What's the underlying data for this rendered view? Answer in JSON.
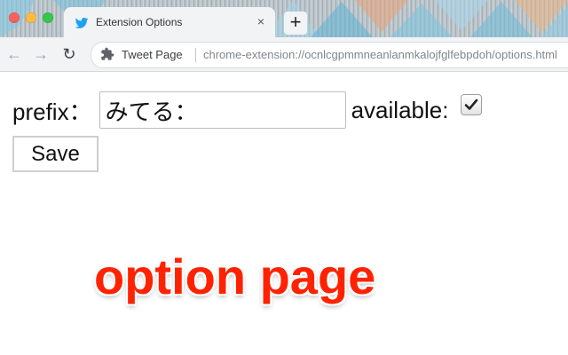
{
  "browser": {
    "tab": {
      "title": "Extension Options",
      "close_glyph": "×"
    },
    "new_tab_glyph": "+",
    "nav": {
      "back_glyph": "←",
      "forward_glyph": "→",
      "reload_glyph": "↻"
    },
    "omnibox": {
      "extension_name": "Tweet Page",
      "url": "chrome-extension://ocnlcgpmmneanlanmkalojfglfebpdoh/options.html"
    },
    "colors": {
      "close": "#fc605b",
      "minimize": "#fdbc40",
      "maximize": "#34c749",
      "tab_bg": "#f1f3f4",
      "twitter_blue": "#1da1f2"
    }
  },
  "options_form": {
    "prefix_label": "prefix：",
    "prefix_value": "みてる：",
    "available_label": "available:",
    "available_checked": true,
    "save_label": "Save"
  },
  "overlay_caption": "option page",
  "icons": [
    "twitter-icon",
    "extension-puzzle-icon",
    "check-icon"
  ]
}
